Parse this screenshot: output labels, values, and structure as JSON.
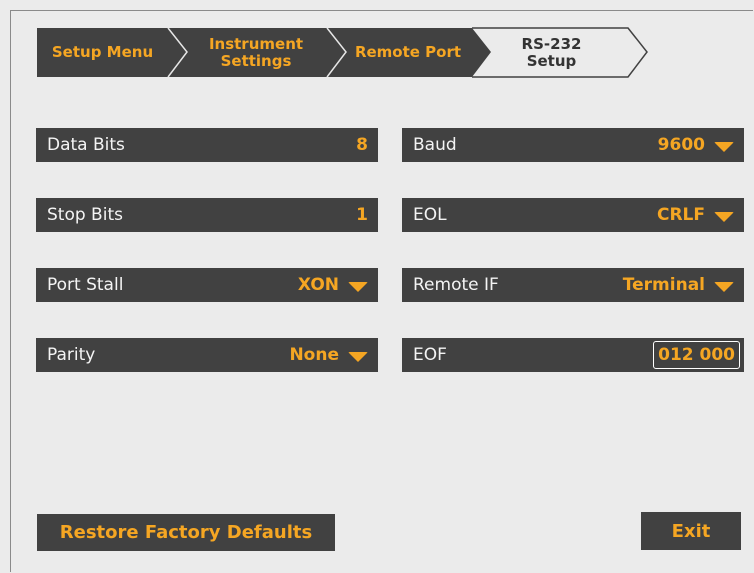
{
  "breadcrumb": [
    {
      "line1": "Setup Menu",
      "line2": ""
    },
    {
      "line1": "Instrument",
      "line2": "Settings"
    },
    {
      "line1": "Remote Port",
      "line2": ""
    },
    {
      "line1": "RS-232",
      "line2": "Setup"
    }
  ],
  "fields": {
    "data_bits": {
      "label": "Data Bits",
      "value": "8"
    },
    "stop_bits": {
      "label": "Stop Bits",
      "value": "1"
    },
    "port_stall": {
      "label": "Port Stall",
      "value": "XON"
    },
    "parity": {
      "label": "Parity",
      "value": "None"
    },
    "baud": {
      "label": "Baud",
      "value": "9600"
    },
    "eol": {
      "label": "EOL",
      "value": "CRLF"
    },
    "remote_if": {
      "label": "Remote IF",
      "value": "Terminal"
    },
    "eof": {
      "label": "EOF",
      "value": "012 000"
    }
  },
  "buttons": {
    "restore": "Restore Factory Defaults",
    "exit": "Exit"
  },
  "colors": {
    "accent": "#f5a623",
    "panel": "#414141",
    "background": "#ebebeb"
  }
}
